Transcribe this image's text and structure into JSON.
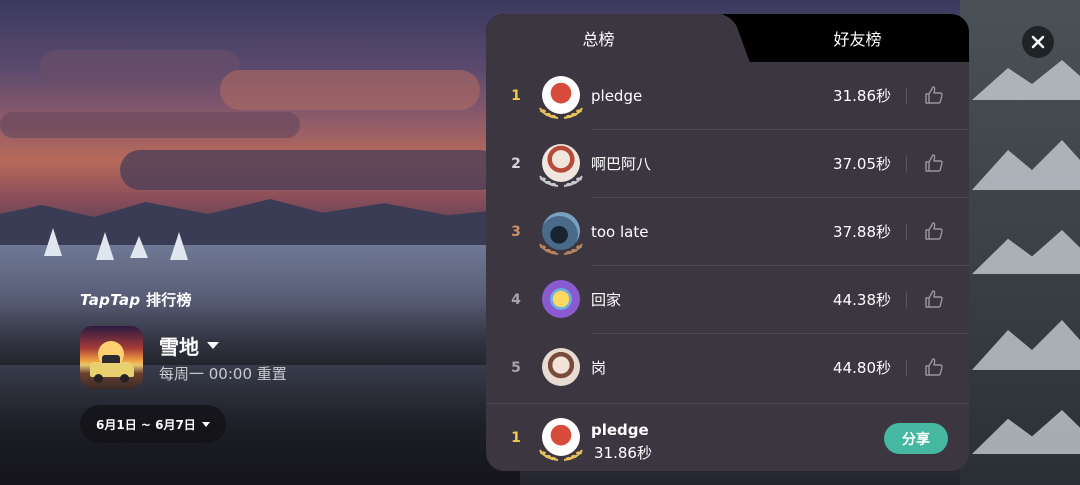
{
  "brand": {
    "name_prefix": "TapTap",
    "name_suffix": " 排行榜"
  },
  "game": {
    "title": "雪地",
    "reset": "每周一 00:00 重置"
  },
  "period": {
    "label": "6月1日 ~ 6月7日"
  },
  "tabs": {
    "overall": "总榜",
    "friends": "好友榜"
  },
  "rows": [
    {
      "rank": "1",
      "name": "pledge",
      "score": "31.86秒",
      "rank_color": "#f2c94c",
      "laurel": "gold",
      "avatar": "red-lantern"
    },
    {
      "rank": "2",
      "name": "啊巴阿八",
      "score": "37.05秒",
      "rank_color": "#d8d8dc",
      "laurel": "silver",
      "avatar": "fox-girl"
    },
    {
      "rank": "3",
      "name": "too late",
      "score": "37.88秒",
      "rank_color": "#c8926a",
      "laurel": "bronze",
      "avatar": "night-silhouette"
    },
    {
      "rank": "4",
      "name": "回家",
      "score": "44.38秒",
      "rank_color": "#a8a4ac",
      "laurel": "none",
      "avatar": "purple-cartoon"
    },
    {
      "rank": "5",
      "name": "岗",
      "score": "44.80秒",
      "rank_color": "#a8a4ac",
      "laurel": "none",
      "avatar": "anime-girl"
    }
  ],
  "me": {
    "rank": "1",
    "name": "pledge",
    "score": "31.86秒",
    "rank_color": "#f2c94c",
    "laurel": "gold",
    "avatar": "red-lantern"
  },
  "actions": {
    "share": "分享"
  },
  "colors": {
    "panel": "#3b3640",
    "share": "#46b7a0",
    "gold": "#f2c94c"
  }
}
